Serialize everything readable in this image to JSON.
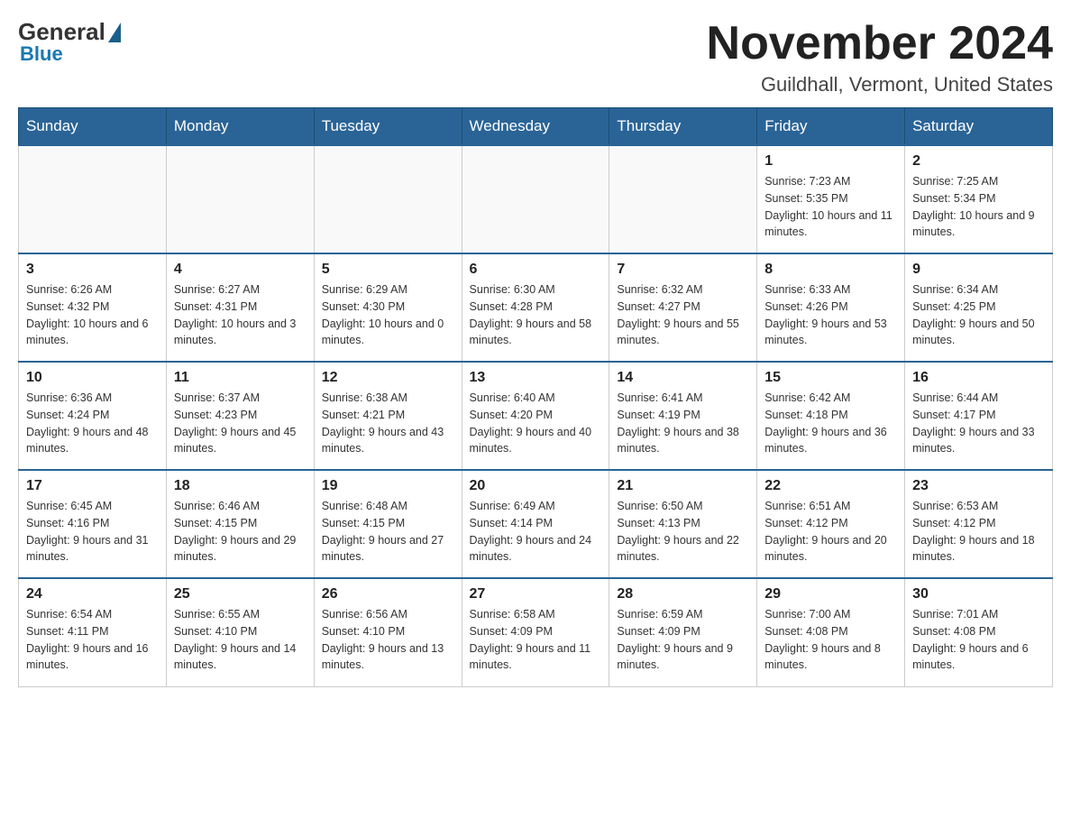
{
  "header": {
    "logo": {
      "general": "General",
      "blue": "Blue"
    },
    "title": "November 2024",
    "location": "Guildhall, Vermont, United States"
  },
  "weekdays": [
    "Sunday",
    "Monday",
    "Tuesday",
    "Wednesday",
    "Thursday",
    "Friday",
    "Saturday"
  ],
  "weeks": [
    [
      {
        "day": "",
        "info": ""
      },
      {
        "day": "",
        "info": ""
      },
      {
        "day": "",
        "info": ""
      },
      {
        "day": "",
        "info": ""
      },
      {
        "day": "",
        "info": ""
      },
      {
        "day": "1",
        "info": "Sunrise: 7:23 AM\nSunset: 5:35 PM\nDaylight: 10 hours and 11 minutes."
      },
      {
        "day": "2",
        "info": "Sunrise: 7:25 AM\nSunset: 5:34 PM\nDaylight: 10 hours and 9 minutes."
      }
    ],
    [
      {
        "day": "3",
        "info": "Sunrise: 6:26 AM\nSunset: 4:32 PM\nDaylight: 10 hours and 6 minutes."
      },
      {
        "day": "4",
        "info": "Sunrise: 6:27 AM\nSunset: 4:31 PM\nDaylight: 10 hours and 3 minutes."
      },
      {
        "day": "5",
        "info": "Sunrise: 6:29 AM\nSunset: 4:30 PM\nDaylight: 10 hours and 0 minutes."
      },
      {
        "day": "6",
        "info": "Sunrise: 6:30 AM\nSunset: 4:28 PM\nDaylight: 9 hours and 58 minutes."
      },
      {
        "day": "7",
        "info": "Sunrise: 6:32 AM\nSunset: 4:27 PM\nDaylight: 9 hours and 55 minutes."
      },
      {
        "day": "8",
        "info": "Sunrise: 6:33 AM\nSunset: 4:26 PM\nDaylight: 9 hours and 53 minutes."
      },
      {
        "day": "9",
        "info": "Sunrise: 6:34 AM\nSunset: 4:25 PM\nDaylight: 9 hours and 50 minutes."
      }
    ],
    [
      {
        "day": "10",
        "info": "Sunrise: 6:36 AM\nSunset: 4:24 PM\nDaylight: 9 hours and 48 minutes."
      },
      {
        "day": "11",
        "info": "Sunrise: 6:37 AM\nSunset: 4:23 PM\nDaylight: 9 hours and 45 minutes."
      },
      {
        "day": "12",
        "info": "Sunrise: 6:38 AM\nSunset: 4:21 PM\nDaylight: 9 hours and 43 minutes."
      },
      {
        "day": "13",
        "info": "Sunrise: 6:40 AM\nSunset: 4:20 PM\nDaylight: 9 hours and 40 minutes."
      },
      {
        "day": "14",
        "info": "Sunrise: 6:41 AM\nSunset: 4:19 PM\nDaylight: 9 hours and 38 minutes."
      },
      {
        "day": "15",
        "info": "Sunrise: 6:42 AM\nSunset: 4:18 PM\nDaylight: 9 hours and 36 minutes."
      },
      {
        "day": "16",
        "info": "Sunrise: 6:44 AM\nSunset: 4:17 PM\nDaylight: 9 hours and 33 minutes."
      }
    ],
    [
      {
        "day": "17",
        "info": "Sunrise: 6:45 AM\nSunset: 4:16 PM\nDaylight: 9 hours and 31 minutes."
      },
      {
        "day": "18",
        "info": "Sunrise: 6:46 AM\nSunset: 4:15 PM\nDaylight: 9 hours and 29 minutes."
      },
      {
        "day": "19",
        "info": "Sunrise: 6:48 AM\nSunset: 4:15 PM\nDaylight: 9 hours and 27 minutes."
      },
      {
        "day": "20",
        "info": "Sunrise: 6:49 AM\nSunset: 4:14 PM\nDaylight: 9 hours and 24 minutes."
      },
      {
        "day": "21",
        "info": "Sunrise: 6:50 AM\nSunset: 4:13 PM\nDaylight: 9 hours and 22 minutes."
      },
      {
        "day": "22",
        "info": "Sunrise: 6:51 AM\nSunset: 4:12 PM\nDaylight: 9 hours and 20 minutes."
      },
      {
        "day": "23",
        "info": "Sunrise: 6:53 AM\nSunset: 4:12 PM\nDaylight: 9 hours and 18 minutes."
      }
    ],
    [
      {
        "day": "24",
        "info": "Sunrise: 6:54 AM\nSunset: 4:11 PM\nDaylight: 9 hours and 16 minutes."
      },
      {
        "day": "25",
        "info": "Sunrise: 6:55 AM\nSunset: 4:10 PM\nDaylight: 9 hours and 14 minutes."
      },
      {
        "day": "26",
        "info": "Sunrise: 6:56 AM\nSunset: 4:10 PM\nDaylight: 9 hours and 13 minutes."
      },
      {
        "day": "27",
        "info": "Sunrise: 6:58 AM\nSunset: 4:09 PM\nDaylight: 9 hours and 11 minutes."
      },
      {
        "day": "28",
        "info": "Sunrise: 6:59 AM\nSunset: 4:09 PM\nDaylight: 9 hours and 9 minutes."
      },
      {
        "day": "29",
        "info": "Sunrise: 7:00 AM\nSunset: 4:08 PM\nDaylight: 9 hours and 8 minutes."
      },
      {
        "day": "30",
        "info": "Sunrise: 7:01 AM\nSunset: 4:08 PM\nDaylight: 9 hours and 6 minutes."
      }
    ]
  ]
}
